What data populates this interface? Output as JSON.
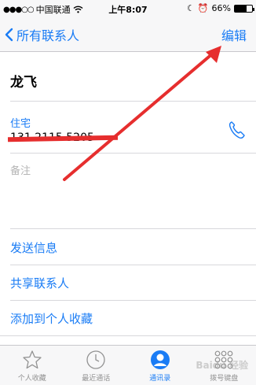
{
  "status_bar": {
    "carrier": "中国联通",
    "time": "上午8:07",
    "battery_percent": "66%",
    "battery_level": 0.66
  },
  "nav": {
    "back_label": "所有联系人",
    "edit_label": "编辑"
  },
  "contact": {
    "name": "龙飞",
    "phone_label": "住宅",
    "phone_value": "131 2115 5205",
    "note_label": "备注"
  },
  "actions": {
    "send_message": "发送信息",
    "share_contact": "共享联系人",
    "add_favorite": "添加到个人收藏"
  },
  "tabs": [
    {
      "label": "个人收藏",
      "icon": "star-icon"
    },
    {
      "label": "最近通话",
      "icon": "clock-icon"
    },
    {
      "label": "通讯录",
      "icon": "contacts-icon"
    },
    {
      "label": "拨号键盘",
      "icon": "keypad-icon"
    }
  ],
  "colors": {
    "accent": "#1a7cf5",
    "annotation": "#e62e2e"
  }
}
